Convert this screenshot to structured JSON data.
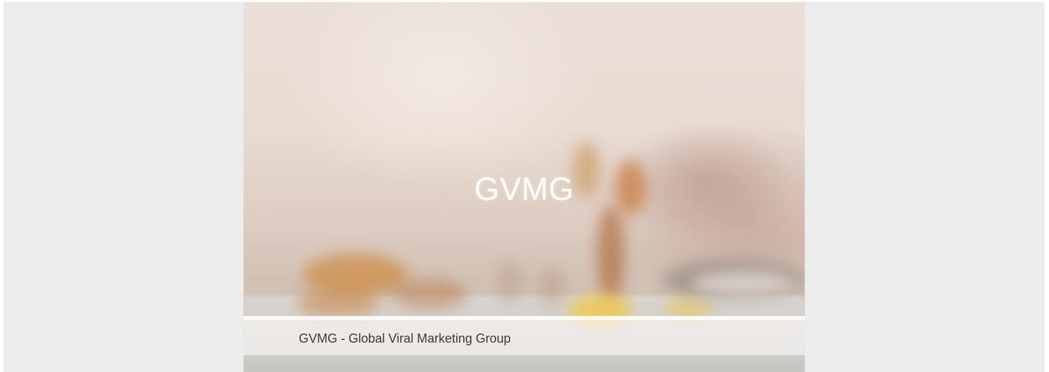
{
  "hero": {
    "title": "GVMG",
    "caption": "GVMG - Global Viral Marketing Group"
  },
  "colors": {
    "page_background": "#ececec",
    "title_text": "#ffffff",
    "caption_text": "#3a3a3a"
  }
}
